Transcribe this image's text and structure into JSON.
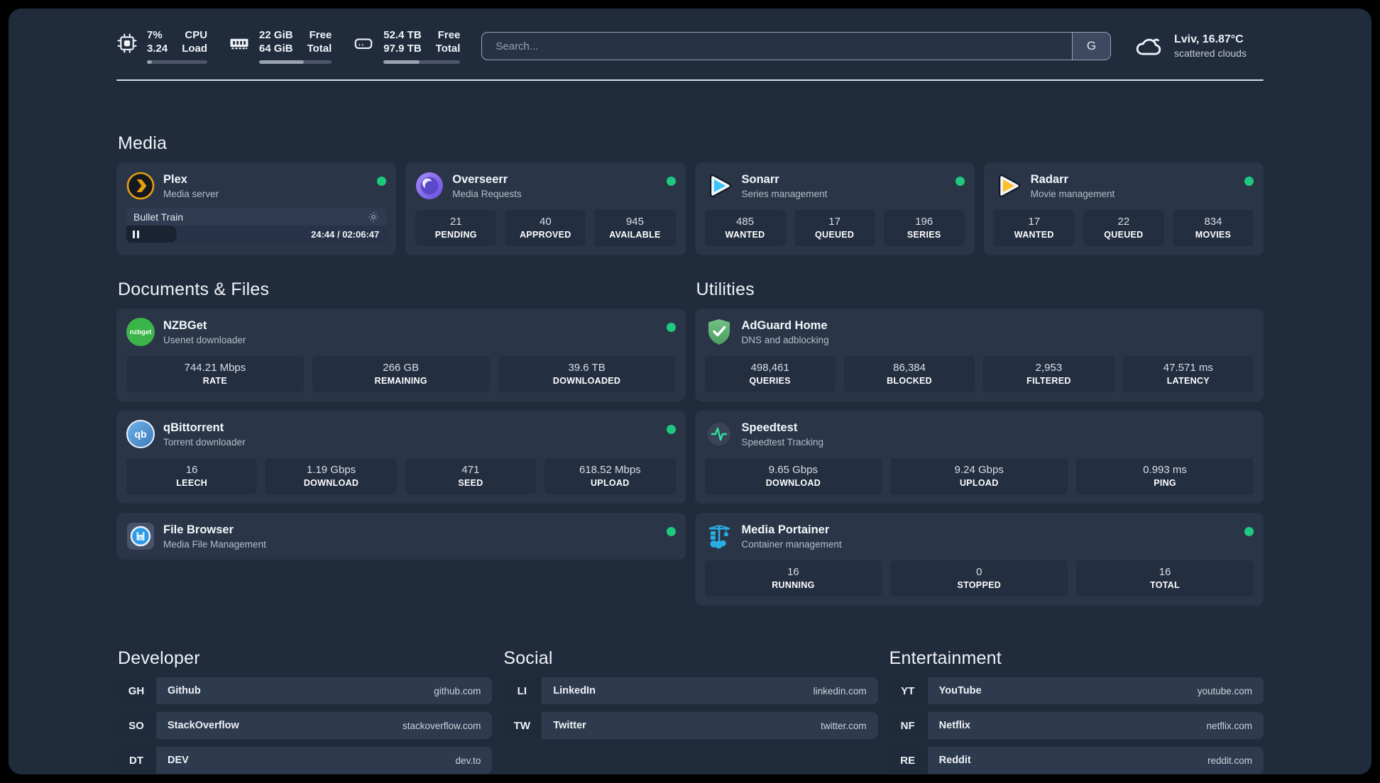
{
  "header": {
    "stats": [
      {
        "icon": "cpu-icon",
        "value_top": "7%",
        "value_bottom": "3.24",
        "label_top": "CPU",
        "label_bottom": "Load",
        "percent": 8
      },
      {
        "icon": "ram-icon",
        "value_top": "22 GiB",
        "value_bottom": "64 GiB",
        "label_top": "Free",
        "label_bottom": "Total",
        "percent": 62
      },
      {
        "icon": "disk-icon",
        "value_top": "52.4 TB",
        "value_bottom": "97.9 TB",
        "label_top": "Free",
        "label_bottom": "Total",
        "percent": 47
      }
    ],
    "search": {
      "placeholder": "Search...",
      "engine_button": "G"
    },
    "weather": {
      "location": "Lviv, 16.87°C",
      "condition": "scattered clouds"
    }
  },
  "sections": {
    "media": {
      "title": "Media",
      "cards": [
        {
          "name": "Plex",
          "subtitle": "Media server",
          "player": {
            "title": "Bullet Train",
            "time": "24:44 / 02:06:47",
            "progress_percent": 19.5
          }
        },
        {
          "name": "Overseerr",
          "subtitle": "Media Requests",
          "stats": [
            {
              "value": "21",
              "label": "PENDING"
            },
            {
              "value": "40",
              "label": "APPROVED"
            },
            {
              "value": "945",
              "label": "AVAILABLE"
            }
          ]
        },
        {
          "name": "Sonarr",
          "subtitle": "Series management",
          "stats": [
            {
              "value": "485",
              "label": "WANTED"
            },
            {
              "value": "17",
              "label": "QUEUED"
            },
            {
              "value": "196",
              "label": "SERIES"
            }
          ]
        },
        {
          "name": "Radarr",
          "subtitle": "Movie management",
          "stats": [
            {
              "value": "17",
              "label": "WANTED"
            },
            {
              "value": "22",
              "label": "QUEUED"
            },
            {
              "value": "834",
              "label": "MOVIES"
            }
          ]
        }
      ]
    },
    "documents": {
      "title": "Documents & Files",
      "cards": [
        {
          "name": "NZBGet",
          "subtitle": "Usenet downloader",
          "icon_label": "nzbget",
          "stats": [
            {
              "value": "744.21 Mbps",
              "label": "RATE"
            },
            {
              "value": "266 GB",
              "label": "REMAINING"
            },
            {
              "value": "39.6 TB",
              "label": "DOWNLOADED"
            }
          ]
        },
        {
          "name": "qBittorrent",
          "subtitle": "Torrent downloader",
          "icon_label": "qb",
          "stats": [
            {
              "value": "16",
              "label": "LEECH"
            },
            {
              "value": "1.19 Gbps",
              "label": "DOWNLOAD"
            },
            {
              "value": "471",
              "label": "SEED"
            },
            {
              "value": "618.52 Mbps",
              "label": "UPLOAD"
            }
          ]
        },
        {
          "name": "File Browser",
          "subtitle": "Media File Management"
        }
      ]
    },
    "utilities": {
      "title": "Utilities",
      "cards": [
        {
          "name": "AdGuard Home",
          "subtitle": "DNS and adblocking",
          "stats": [
            {
              "value": "498,461",
              "label": "QUERIES"
            },
            {
              "value": "86,384",
              "label": "BLOCKED"
            },
            {
              "value": "2,953",
              "label": "FILTERED"
            },
            {
              "value": "47.571 ms",
              "label": "LATENCY"
            }
          ]
        },
        {
          "name": "Speedtest",
          "subtitle": "Speedtest Tracking",
          "stats": [
            {
              "value": "9.65 Gbps",
              "label": "DOWNLOAD"
            },
            {
              "value": "9.24 Gbps",
              "label": "UPLOAD"
            },
            {
              "value": "0.993 ms",
              "label": "PING"
            }
          ]
        },
        {
          "name": "Media Portainer",
          "subtitle": "Container management",
          "stats": [
            {
              "value": "16",
              "label": "RUNNING"
            },
            {
              "value": "0",
              "label": "STOPPED"
            },
            {
              "value": "16",
              "label": "TOTAL"
            }
          ]
        }
      ]
    }
  },
  "bookmarks": [
    {
      "title": "Developer",
      "links": [
        {
          "abbr": "GH",
          "name": "Github",
          "url": "github.com"
        },
        {
          "abbr": "SO",
          "name": "StackOverflow",
          "url": "stackoverflow.com"
        },
        {
          "abbr": "DT",
          "name": "DEV",
          "url": "dev.to"
        }
      ]
    },
    {
      "title": "Social",
      "links": [
        {
          "abbr": "LI",
          "name": "LinkedIn",
          "url": "linkedin.com"
        },
        {
          "abbr": "TW",
          "name": "Twitter",
          "url": "twitter.com"
        }
      ]
    },
    {
      "title": "Entertainment",
      "links": [
        {
          "abbr": "YT",
          "name": "YouTube",
          "url": "youtube.com"
        },
        {
          "abbr": "NF",
          "name": "Netflix",
          "url": "netflix.com"
        },
        {
          "abbr": "RE",
          "name": "Reddit",
          "url": "reddit.com"
        }
      ]
    }
  ],
  "colors": {
    "status_green": "#1ec97d",
    "plex_amber": "#e5a00d",
    "sonarr_cyan": "#3cc5f5",
    "radarr_yellow": "#ffbe2e",
    "adguard_green": "#68bc71",
    "portainer_blue": "#29aee4",
    "nzbget_green": "#3bb54a",
    "qbittorrent_blue": "#468fd5"
  }
}
